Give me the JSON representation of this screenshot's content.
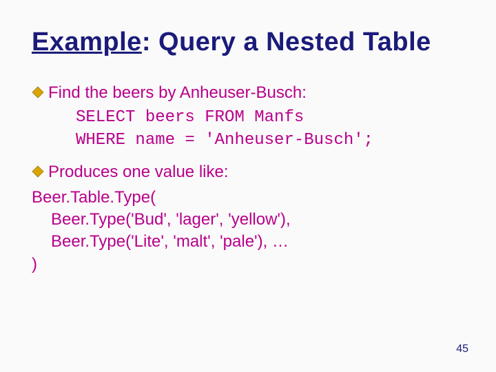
{
  "title": {
    "word_example": "Example",
    "rest": ": Query a Nested Table"
  },
  "bullets": {
    "b1": "Find the beers by Anheuser-Busch:",
    "b2": "Produces one value like:"
  },
  "code": {
    "l1": "SELECT beers FROM Manfs",
    "l2": "WHERE name = 'Anheuser-Busch';"
  },
  "body": {
    "l1": "Beer.Table.Type(",
    "l2": "Beer.Type('Bud', 'lager', 'yellow'),",
    "l3": "Beer.Type('Lite', 'malt', 'pale'), …",
    "l4": ")"
  },
  "page_number": "45"
}
